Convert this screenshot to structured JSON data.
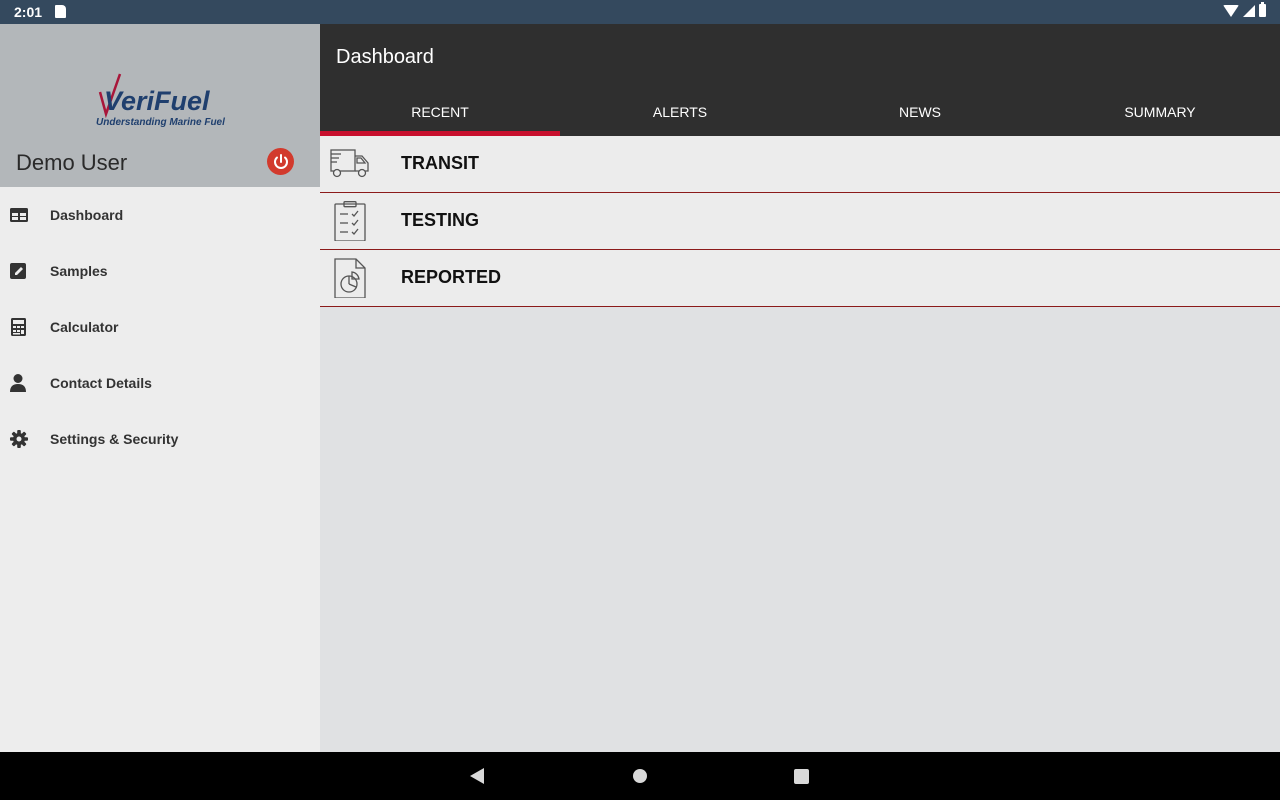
{
  "status_bar": {
    "time": "2:01"
  },
  "sidebar": {
    "logo": {
      "brand": "VeriFuel",
      "tagline": "Understanding Marine Fuel"
    },
    "user_name": "Demo User",
    "items": [
      {
        "label": "Dashboard",
        "icon": "table-icon"
      },
      {
        "label": "Samples",
        "icon": "edit-icon"
      },
      {
        "label": "Calculator",
        "icon": "calculator-icon"
      },
      {
        "label": "Contact Details",
        "icon": "person-icon"
      },
      {
        "label": "Settings & Security",
        "icon": "gear-icon"
      }
    ]
  },
  "appbar": {
    "title": "Dashboard",
    "tabs": [
      {
        "label": "RECENT",
        "active": true
      },
      {
        "label": "ALERTS",
        "active": false
      },
      {
        "label": "NEWS",
        "active": false
      },
      {
        "label": "SUMMARY",
        "active": false
      }
    ]
  },
  "list": [
    {
      "label": "TRANSIT",
      "icon": "truck-icon"
    },
    {
      "label": "TESTING",
      "icon": "clipboard-check-icon"
    },
    {
      "label": "REPORTED",
      "icon": "document-chart-icon"
    }
  ],
  "colors": {
    "accent": "#c8102e",
    "appbar": "#2f2f2f",
    "sidebar_header": "#b3b7ba",
    "power": "#d23a2d",
    "logo_red": "#a8163a",
    "logo_blue": "#1f3f6e"
  }
}
